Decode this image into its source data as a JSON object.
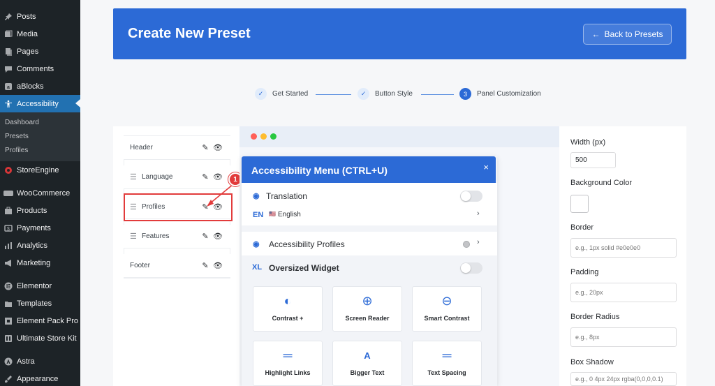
{
  "sidebar": {
    "items": [
      {
        "label": "Posts",
        "icon": "pin-icon"
      },
      {
        "label": "Media",
        "icon": "media-icon"
      },
      {
        "label": "Pages",
        "icon": "pages-icon"
      },
      {
        "label": "Comments",
        "icon": "comments-icon"
      },
      {
        "label": "aBlocks",
        "icon": "ablocks-icon"
      },
      {
        "label": "Accessibility",
        "icon": "accessibility-icon",
        "active": true
      },
      {
        "label": "StoreEngine",
        "icon": "storeengine-icon"
      },
      {
        "label": "WooCommerce",
        "icon": "woocommerce-icon"
      },
      {
        "label": "Products",
        "icon": "products-icon"
      },
      {
        "label": "Payments",
        "icon": "payments-icon"
      },
      {
        "label": "Analytics",
        "icon": "analytics-icon"
      },
      {
        "label": "Marketing",
        "icon": "marketing-icon"
      },
      {
        "label": "Elementor",
        "icon": "elementor-icon"
      },
      {
        "label": "Templates",
        "icon": "templates-icon"
      },
      {
        "label": "Element Pack Pro",
        "icon": "element-pack-icon"
      },
      {
        "label": "Ultimate Store Kit",
        "icon": "store-kit-icon"
      },
      {
        "label": "Astra",
        "icon": "astra-icon"
      },
      {
        "label": "Appearance",
        "icon": "appearance-icon"
      }
    ],
    "submenu": [
      "Dashboard",
      "Presets",
      "Profiles"
    ]
  },
  "header": {
    "title": "Create New Preset",
    "back_label": "Back to Presets"
  },
  "steps": [
    {
      "label": "Get Started",
      "marker": "✓"
    },
    {
      "label": "Button Style",
      "marker": "✓"
    },
    {
      "label": "Panel Customization",
      "marker": "3"
    }
  ],
  "sections_list": [
    "Header",
    "Language",
    "Profiles",
    "Features",
    "Footer"
  ],
  "annotation": {
    "badge": "1"
  },
  "menu": {
    "title": "Accessibility Menu (CTRL+U)",
    "close": "×",
    "translation_label": "Translation",
    "lang_code": "EN",
    "lang_flag": "🇺🇸",
    "lang_name": "English",
    "profiles_label": "Accessibility Profiles",
    "oversized_code": "XL",
    "oversized_label": "Oversized Widget",
    "tiles": [
      {
        "label": "Contrast +",
        "icon": "contrast-icon"
      },
      {
        "label": "Screen Reader",
        "icon": "screen-reader-icon"
      },
      {
        "label": "Smart Contrast",
        "icon": "smart-contrast-icon"
      },
      {
        "label": "Highlight Links",
        "icon": "highlight-links-icon"
      },
      {
        "label": "Bigger Text",
        "icon": "bigger-text-icon",
        "glyph": "A"
      },
      {
        "label": "Text Spacing",
        "icon": "text-spacing-icon"
      }
    ]
  },
  "settings": {
    "width_label": "Width (px)",
    "width_value": "500",
    "bg_label": "Background Color",
    "border_label": "Border",
    "border_placeholder": "e.g., 1px solid #e0e0e0",
    "padding_label": "Padding",
    "padding_placeholder": "e.g., 20px",
    "radius_label": "Border Radius",
    "radius_placeholder": "e.g., 8px",
    "shadow_label": "Box Shadow",
    "shadow_placeholder": "e.g., 0 4px 24px rgba(0,0,0,0.1)"
  },
  "colors": {
    "accent": "#2c6ad6",
    "wp_sidebar": "#1d2327",
    "highlight": "#e23b3b"
  }
}
